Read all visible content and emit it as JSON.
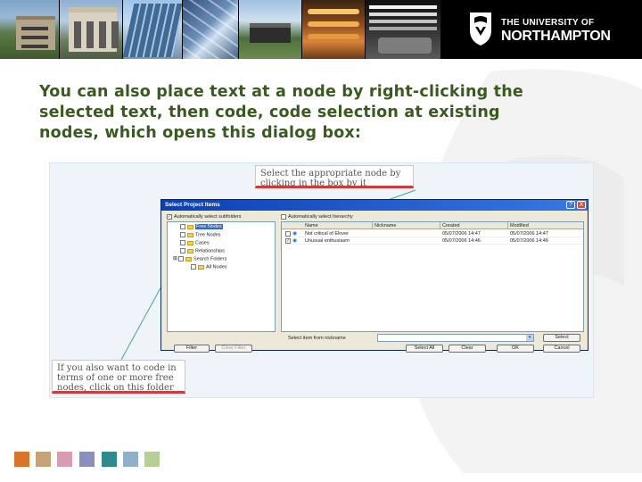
{
  "banner": {
    "logo_line1": "THE UNIVERSITY OF",
    "logo_line2": "NORTHAMPTON"
  },
  "heading": {
    "line1": "You can also place text at a node by right-clicking the",
    "line2": "selected text, then code, code selection at existing",
    "line3": "nodes, which opens this dialog box:"
  },
  "callouts": {
    "top_line1": "Select the appropriate node by",
    "top_line2": "clicking in the box by it",
    "bottom_line1": "If you also want to code in",
    "bottom_line2": "terms of one or more free",
    "bottom_line3": "nodes, click on this folder"
  },
  "dialog": {
    "title": "Select Project Items",
    "help_glyph": "?",
    "close_glyph": "X",
    "auto_select_subfolders": "Automatically select subfolders",
    "auto_select_hierarchy": "Automatically select hierarchy",
    "tree": [
      {
        "label": "Free Nodes",
        "selected": true
      },
      {
        "label": "Tree Nodes",
        "selected": false
      },
      {
        "label": "Cases",
        "selected": false
      },
      {
        "label": "Relationships",
        "selected": false
      },
      {
        "label": "Search Folders",
        "selected": false
      },
      {
        "label": "All Nodes",
        "selected": false
      }
    ],
    "columns": {
      "name": "Name",
      "nickname": "Nickname",
      "created": "Created",
      "modified": "Modified"
    },
    "rows": [
      {
        "name": "Not critical of Elover",
        "nickname": "",
        "created": "05/07/2006 14:47",
        "modified": "05/07/2006 14:47"
      },
      {
        "name": "Unusual enthusiasm",
        "nickname": "",
        "created": "05/07/2006 14:46",
        "modified": "05/07/2006 14:46"
      }
    ],
    "select_item_label": "Select item from nickname",
    "buttons": {
      "select": "Select",
      "filter": "Filter",
      "clear_filter": "Clear Filter",
      "select_all": "Select All",
      "clear": "Clear",
      "ok": "OK",
      "cancel": "Cancel"
    }
  },
  "colors": {
    "heading": "#3a5a20",
    "callout_border": "#d33a3a",
    "squares": [
      "#d9752a",
      "#c4a27a",
      "#d89bb2",
      "#8a8fc0",
      "#2f8a8f",
      "#8fb0c8",
      "#b5cf96"
    ]
  }
}
